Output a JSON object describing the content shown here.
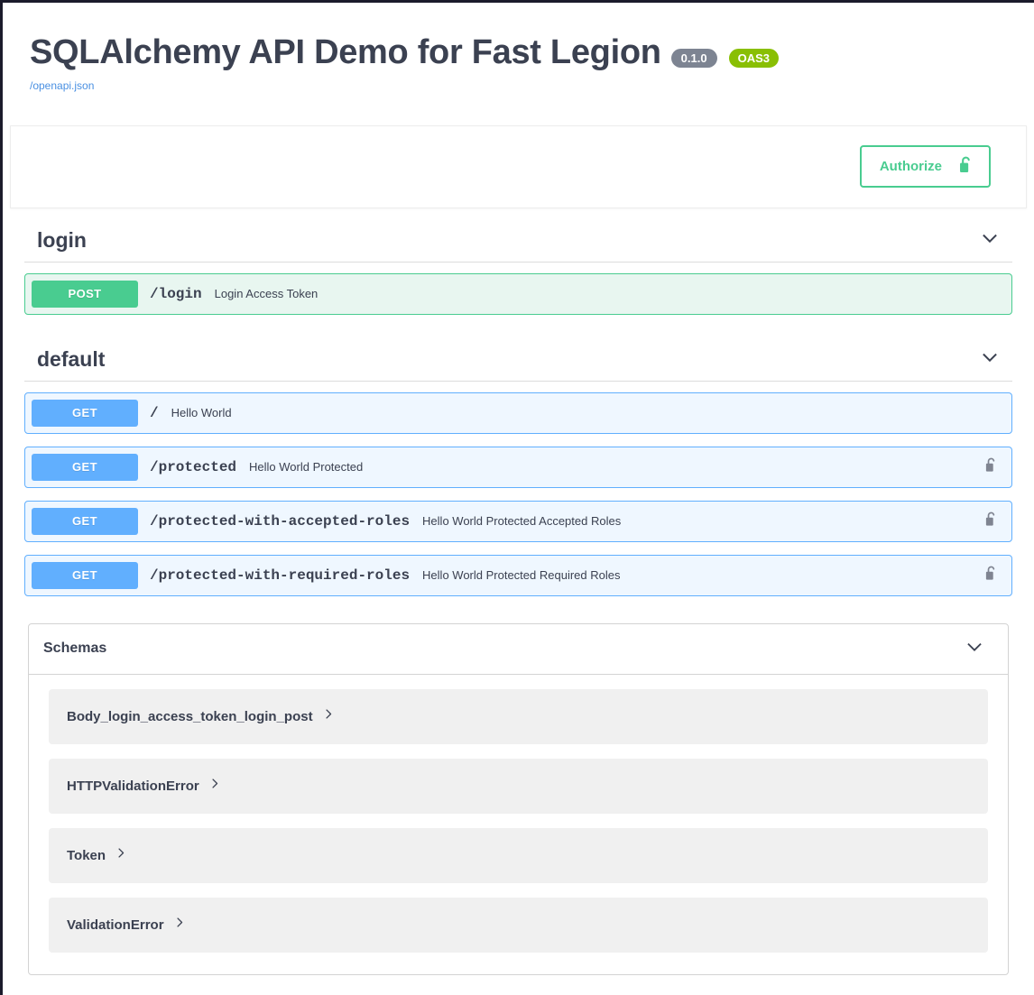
{
  "info": {
    "title": "SQLAlchemy API Demo for Fast Legion",
    "version_badge": "0.1.0",
    "oas_badge": "OAS3",
    "spec_link": "/openapi.json"
  },
  "auth": {
    "authorize_label": "Authorize",
    "lock_icon": "lock-open-icon"
  },
  "colors": {
    "post": "#49cc90",
    "get": "#61affe",
    "post_bg": "#e8f6f0",
    "get_bg": "#eff7ff",
    "version_badge_bg": "#7d8492",
    "oas_badge_bg": "#89bf04",
    "link": "#4a90e2",
    "text": "#3b4151",
    "lock_gray": "#7f8491"
  },
  "tags": [
    {
      "name": "login",
      "chevron": "chevron-down-icon",
      "operations": [
        {
          "method": "POST",
          "method_class": "post",
          "path": "/login",
          "summary": "Login Access Token",
          "locked": false
        }
      ]
    },
    {
      "name": "default",
      "chevron": "chevron-down-icon",
      "operations": [
        {
          "method": "GET",
          "method_class": "get",
          "path": "/",
          "summary": "Hello World",
          "locked": false
        },
        {
          "method": "GET",
          "method_class": "get",
          "path": "/protected",
          "summary": "Hello World Protected",
          "locked": true
        },
        {
          "method": "GET",
          "method_class": "get",
          "path": "/protected-with-accepted-roles",
          "summary": "Hello World Protected Accepted Roles",
          "locked": true
        },
        {
          "method": "GET",
          "method_class": "get",
          "path": "/protected-with-required-roles",
          "summary": "Hello World Protected Required Roles",
          "locked": true
        }
      ]
    }
  ],
  "models": {
    "title": "Schemas",
    "chevron": "chevron-down-icon",
    "items": [
      {
        "name": "Body_login_access_token_login_post",
        "chevron": "chevron-right-icon"
      },
      {
        "name": "HTTPValidationError",
        "chevron": "chevron-right-icon"
      },
      {
        "name": "Token",
        "chevron": "chevron-right-icon"
      },
      {
        "name": "ValidationError",
        "chevron": "chevron-right-icon"
      }
    ]
  }
}
